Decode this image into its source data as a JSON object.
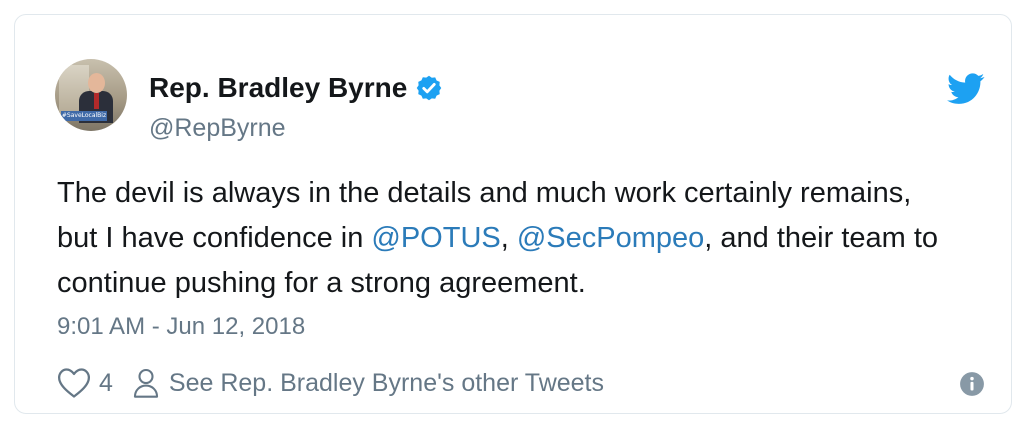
{
  "author": {
    "display_name": "Rep. Bradley Byrne",
    "handle": "@RepByrne",
    "verified": true,
    "avatar_sign_text": "#SaveLocalBiz"
  },
  "tweet": {
    "text_part1": "The devil is always in the details and much work certainly remains, but I have confidence in ",
    "mention1": "@POTUS",
    "text_part2": ", ",
    "mention2": "@SecPompeo",
    "text_part3": ", and their team to continue pushing for a strong agreement.",
    "timestamp": "9:01 AM - Jun 12, 2018"
  },
  "actions": {
    "like_count": "4",
    "other_tweets_label": "See Rep. Bradley Byrne's other Tweets"
  },
  "icons": {
    "brand": "twitter-bird-icon",
    "verified": "verified-badge-icon",
    "like": "heart-icon",
    "profile": "person-icon",
    "info": "info-icon"
  },
  "colors": {
    "twitter_blue": "#1da1f2",
    "mention_blue": "#2b7bb9",
    "text_dark": "#14171a",
    "text_gray": "#657786",
    "border": "#e1e8ed"
  }
}
